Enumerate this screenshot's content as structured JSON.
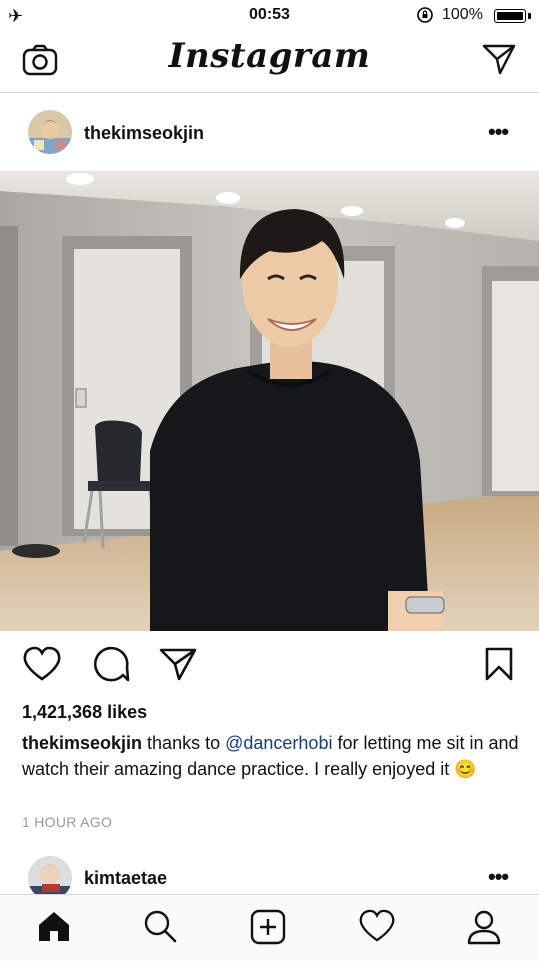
{
  "status_bar": {
    "time": "00:53",
    "battery_percent": "100%",
    "icons": [
      "airplane-icon",
      "orientation-lock-icon",
      "battery-icon"
    ]
  },
  "header": {
    "logo": "Instagram",
    "left_icon": "camera-icon",
    "right_icon": "direct-message-icon"
  },
  "post": {
    "username": "thekimseokjin",
    "likes": "1,421,368 likes",
    "caption": {
      "username": "thekimseokjin",
      "text_before": " thanks to ",
      "mention": "@dancerhobi",
      "text_after": " for letting me sit in and watch their amazing dance practice. I really enjoyed it ",
      "emoji": "😊"
    },
    "time_ago": "1 HOUR AGO",
    "action_icons": [
      "heart-icon",
      "comment-icon",
      "share-icon",
      "bookmark-icon"
    ]
  },
  "next_post": {
    "username": "kimtaetae"
  },
  "tab_bar": {
    "icons": [
      "home-icon",
      "search-icon",
      "add-post-icon",
      "activity-icon",
      "profile-icon"
    ]
  }
}
